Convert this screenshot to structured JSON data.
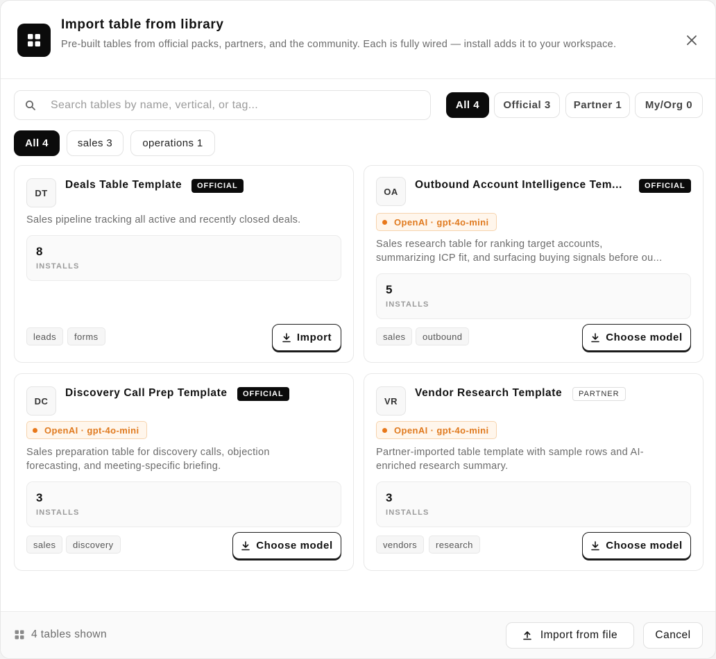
{
  "header": {
    "title": "Import table from library",
    "subtitle": "Pre-built tables from official packs, partners, and the community. Each is fully wired — install adds it to your workspace."
  },
  "search": {
    "placeholder": "Search tables by name, vertical, or tag...",
    "value": ""
  },
  "source_filters": [
    {
      "label": "All 4",
      "active": true
    },
    {
      "label": "Official 3",
      "active": false
    },
    {
      "label": "Partner 1",
      "active": false
    },
    {
      "label": "My/Org 0",
      "active": false
    }
  ],
  "category_filters": [
    {
      "label": "All 4",
      "active": true
    },
    {
      "label": "sales 3",
      "active": false
    },
    {
      "label": "operations 1",
      "active": false
    }
  ],
  "cards": [
    {
      "initials": "DT",
      "title": "Deals Table Template",
      "badge": "OFFICIAL",
      "model": null,
      "description": [
        "Sales pipeline tracking all active and recently closed deals."
      ],
      "installs": "8",
      "installs_label": "INSTALLS",
      "tags": [
        "leads",
        "forms"
      ],
      "action": "Import"
    },
    {
      "initials": "OA",
      "title": "Outbound Account Intelligence Tem...",
      "badge": "OFFICIAL",
      "model": "OpenAI · gpt-4o-mini",
      "description": [
        "Sales research table for ranking target accounts,",
        "summarizing ICP fit, and surfacing buying signals before ou..."
      ],
      "installs": "5",
      "installs_label": "INSTALLS",
      "tags": [
        "sales",
        "outbound"
      ],
      "action": "Choose model"
    },
    {
      "initials": "DC",
      "title": "Discovery Call Prep Template",
      "badge": "OFFICIAL",
      "model": "OpenAI · gpt-4o-mini",
      "description": [
        "Sales preparation table for discovery calls, objection",
        "forecasting, and meeting-specific briefing."
      ],
      "installs": "3",
      "installs_label": "INSTALLS",
      "tags": [
        "sales",
        "discovery"
      ],
      "action": "Choose model"
    },
    {
      "initials": "VR",
      "title": "Vendor Research Template",
      "badge": "PARTNER",
      "model": "OpenAI · gpt-4o-mini",
      "description": [
        "Partner-imported table template with sample rows and AI-",
        "enriched research summary."
      ],
      "installs": "3",
      "installs_label": "INSTALLS",
      "tags": [
        "vendors",
        "research"
      ],
      "action": "Choose model"
    }
  ],
  "footer": {
    "count": "4 tables shown",
    "import_file": "Import from file",
    "cancel": "Cancel"
  },
  "colors": {
    "accent": "#0b0b0b",
    "model_text": "#e07a1f",
    "model_bg": "#fff6ec"
  }
}
